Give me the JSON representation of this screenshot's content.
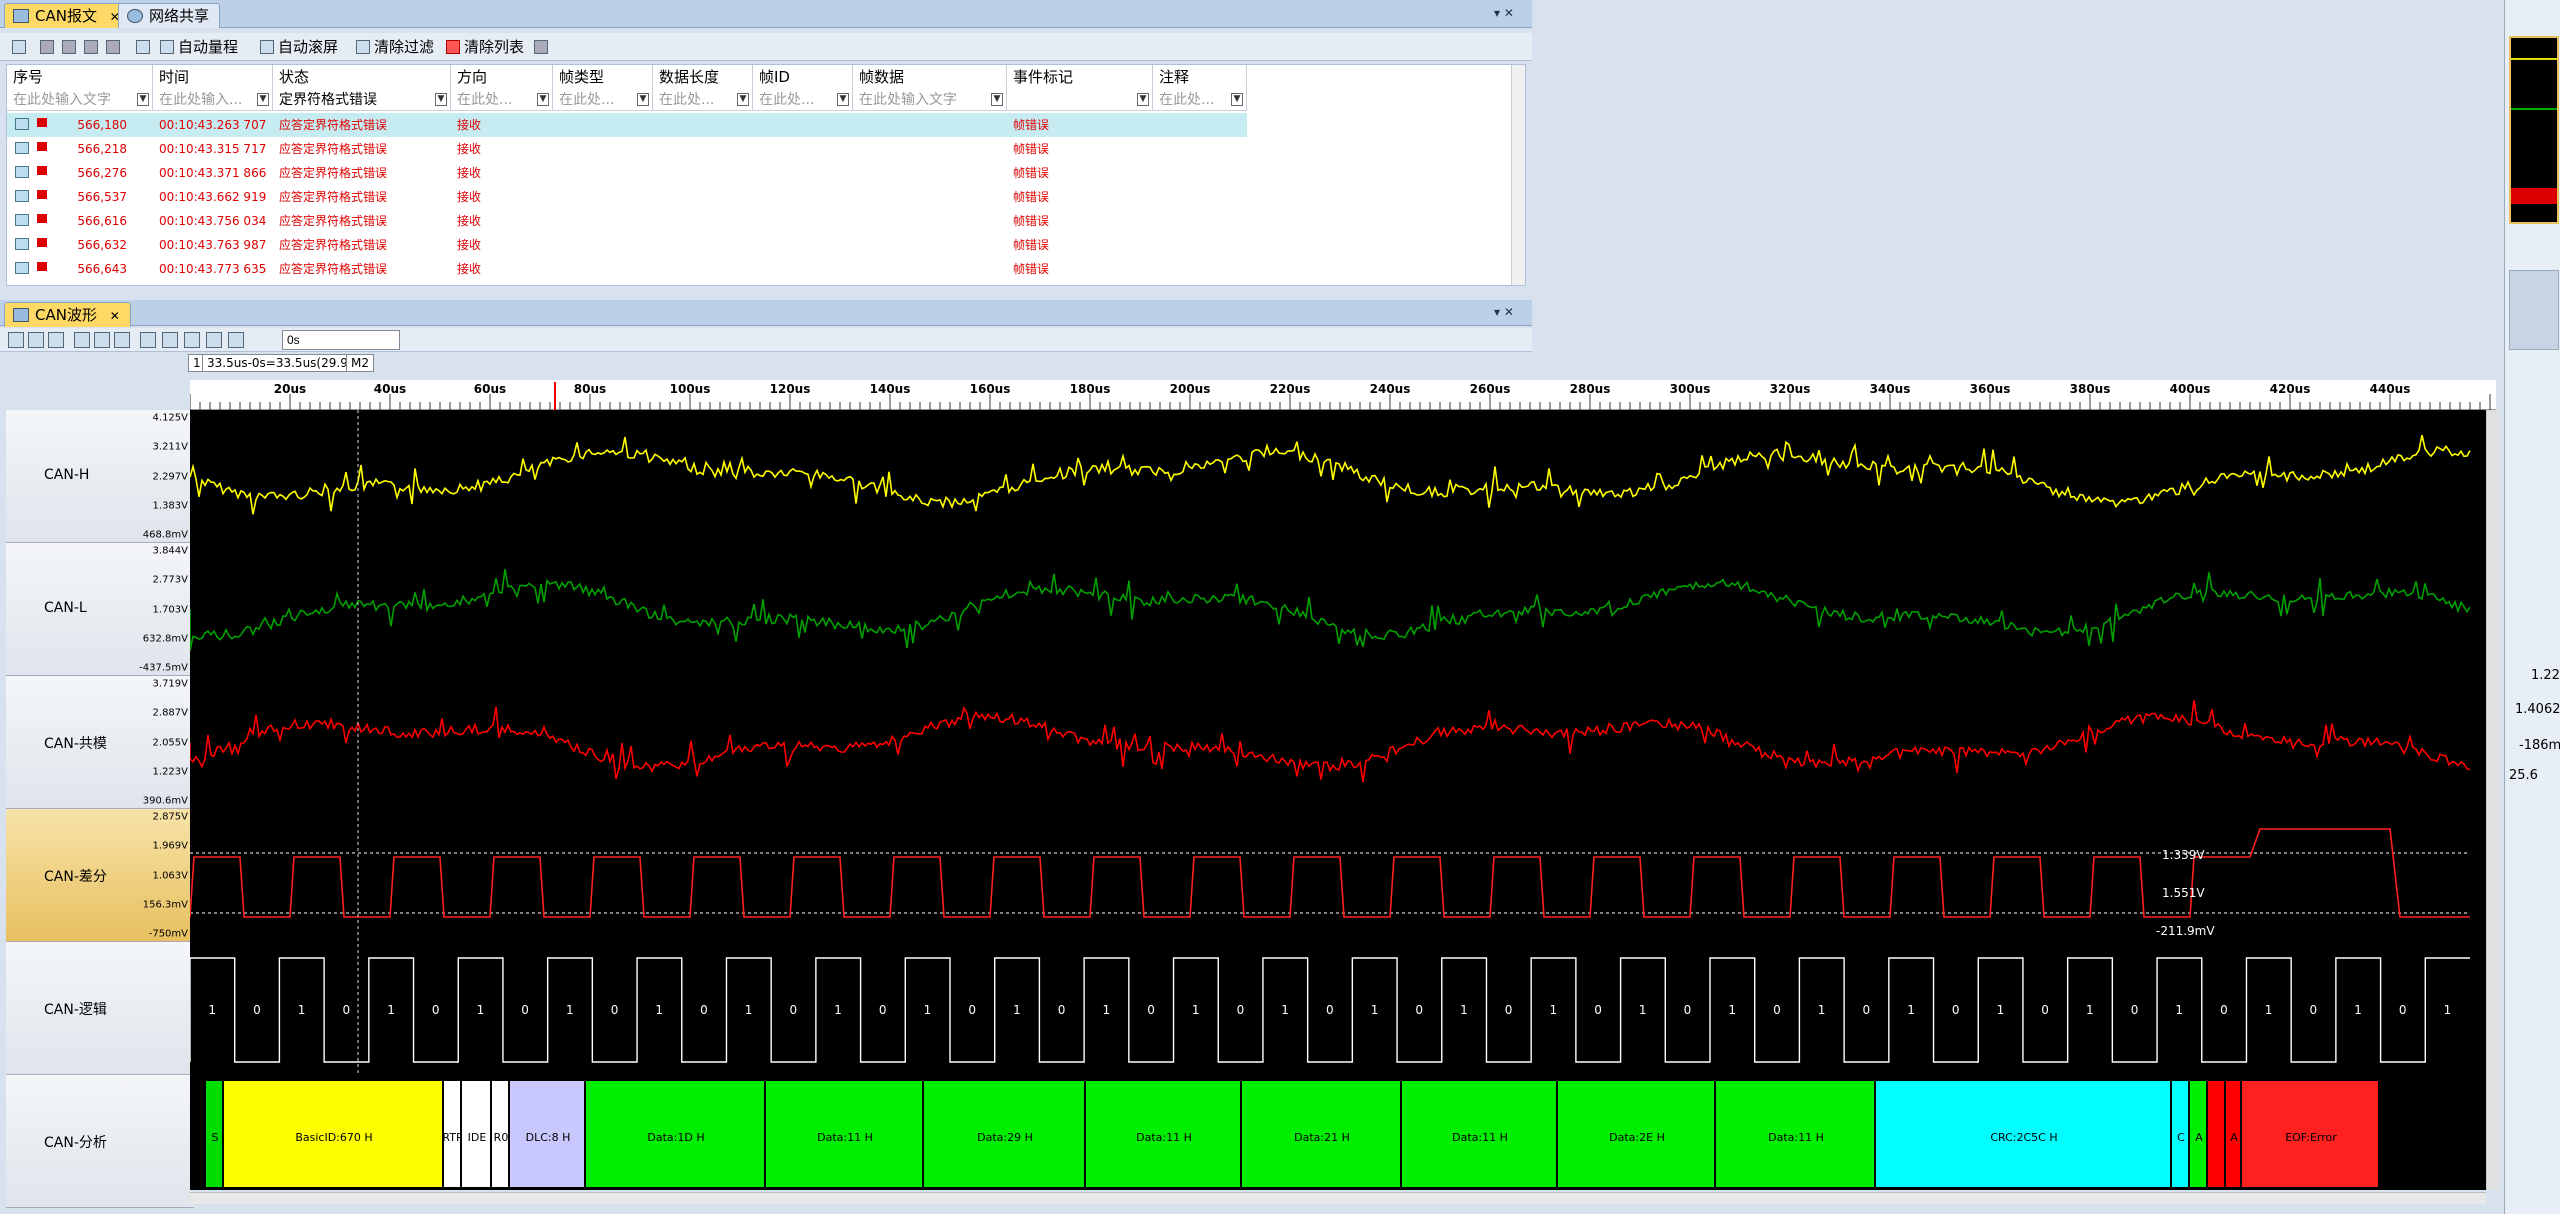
{
  "top_tabs": [
    {
      "label": "CAN报文",
      "active": true
    },
    {
      "label": "网络共享",
      "active": false
    }
  ],
  "msg_toolbar": {
    "auto_range": "自动量程",
    "auto_scroll": "自动滚屏",
    "clear_filter": "清除过滤",
    "clear_list": "清除列表"
  },
  "grid": {
    "columns": [
      "序号",
      "时间",
      "状态",
      "方向",
      "帧类型",
      "数据长度",
      "帧ID",
      "帧数据",
      "事件标记",
      "注释"
    ],
    "filters": [
      "在此处输入文字",
      "在此处输入...",
      "定界符格式错误",
      "在此处...",
      "在此处...",
      "在此处...",
      "在此处...",
      "在此处输入文字",
      "",
      "在此处..."
    ],
    "rows": [
      {
        "seq": "566,180",
        "time": "00:10:43.263 707",
        "status": "应答定界符格式错误",
        "dir": "接收",
        "event": "帧错误"
      },
      {
        "seq": "566,218",
        "time": "00:10:43.315 717",
        "status": "应答定界符格式错误",
        "dir": "接收",
        "event": "帧错误"
      },
      {
        "seq": "566,276",
        "time": "00:10:43.371 866",
        "status": "应答定界符格式错误",
        "dir": "接收",
        "event": "帧错误"
      },
      {
        "seq": "566,537",
        "time": "00:10:43.662 919",
        "status": "应答定界符格式错误",
        "dir": "接收",
        "event": "帧错误"
      },
      {
        "seq": "566,616",
        "time": "00:10:43.756 034",
        "status": "应答定界符格式错误",
        "dir": "接收",
        "event": "帧错误"
      },
      {
        "seq": "566,632",
        "time": "00:10:43.763 987",
        "status": "应答定界符格式错误",
        "dir": "接收",
        "event": "帧错误"
      },
      {
        "seq": "566,643",
        "time": "00:10:43.773 635",
        "status": "应答定界符格式错误",
        "dir": "接收",
        "event": "帧错误"
      }
    ]
  },
  "wave_tab": {
    "label": "CAN波形"
  },
  "wave_toolbar": {
    "cursor_value": "0s",
    "cursor_info": "33.5us-0s=33.5us(29.9...",
    "cursor_mark": "M2",
    "cursor_num": "1"
  },
  "ruler_labels": [
    "20us",
    "40us",
    "60us",
    "80us",
    "100us",
    "120us",
    "140us",
    "160us",
    "180us",
    "200us",
    "220us",
    "240us",
    "260us",
    "280us",
    "300us",
    "320us",
    "340us",
    "360us",
    "380us",
    "400us",
    "420us",
    "440us"
  ],
  "channels": [
    {
      "name": "CAN-H",
      "color": "#ffff00",
      "ticks": [
        "4.125V",
        "3.211V",
        "2.297V",
        "1.383V",
        "468.8mV"
      ]
    },
    {
      "name": "CAN-L",
      "color": "#00a000",
      "ticks": [
        "3.844V",
        "2.773V",
        "1.703V",
        "632.8mV",
        "-437.5mV"
      ]
    },
    {
      "name": "CAN-共模",
      "color": "#ff0000",
      "ticks": [
        "3.719V",
        "2.887V",
        "2.055V",
        "1.223V",
        "390.6mV"
      ]
    },
    {
      "name": "CAN-差分",
      "color": "#ff2020",
      "ticks": [
        "2.875V",
        "1.969V",
        "1.063V",
        "156.3mV",
        "-750mV"
      ]
    },
    {
      "name": "CAN-逻辑",
      "color": "#ffffff",
      "ticks": []
    },
    {
      "name": "CAN-分析",
      "color": "#ffffff",
      "ticks": []
    }
  ],
  "measurements": {
    "upper": "1.339V",
    "delta": "1.551V",
    "lower": "-211.9mV"
  },
  "logic_bits": [
    "1",
    "0",
    "1",
    "0",
    "1",
    "0",
    "1",
    "0",
    "1",
    "0",
    "1",
    "0",
    "1",
    "0",
    "1",
    "0",
    "1",
    "0",
    "1",
    "0",
    "1",
    "0",
    "1",
    "0",
    "1",
    "0",
    "1",
    "0",
    "1",
    "0",
    "1",
    "0",
    "1",
    "0",
    "1",
    "0",
    "1",
    "0",
    "1",
    "0",
    "1",
    "0",
    "1",
    "0",
    "1",
    "0",
    "1",
    "0",
    "1",
    "0",
    "1"
  ],
  "analysis_segments": [
    {
      "label": "S",
      "color": "#00dd00"
    },
    {
      "label": "BasicID:670 H",
      "color": "#ffff00"
    },
    {
      "label": "RTR",
      "color": "#ffffff"
    },
    {
      "label": "IDE",
      "color": "#ffffff"
    },
    {
      "label": "R0",
      "color": "#ffffff"
    },
    {
      "label": "DLC:8 H",
      "color": "#c8c8ff"
    },
    {
      "label": "Data:1D H",
      "color": "#00ee00"
    },
    {
      "label": "Data:11 H",
      "color": "#00ee00"
    },
    {
      "label": "Data:29 H",
      "color": "#00ee00"
    },
    {
      "label": "Data:11 H",
      "color": "#00ee00"
    },
    {
      "label": "Data:21 H",
      "color": "#00ee00"
    },
    {
      "label": "Data:11 H",
      "color": "#00ee00"
    },
    {
      "label": "Data:2E H",
      "color": "#00ee00"
    },
    {
      "label": "Data:11 H",
      "color": "#00ee00"
    },
    {
      "label": "CRC:2C5C H",
      "color": "#00ffff"
    },
    {
      "label": "C",
      "color": "#00ffff"
    },
    {
      "label": "A",
      "color": "#00ee00"
    },
    {
      "label": "",
      "color": "#ff0000"
    },
    {
      "label": "A",
      "color": "#ff0000"
    },
    {
      "label": "EOF:Error",
      "color": "#ff2020"
    }
  ],
  "side_panel": {
    "values": [
      "1.22",
      "1.4062",
      "-186m",
      "25.6"
    ]
  },
  "colors": {
    "accent": "#ffd966",
    "error_text": "#e00000",
    "selected_row": "#c6ecf2"
  }
}
